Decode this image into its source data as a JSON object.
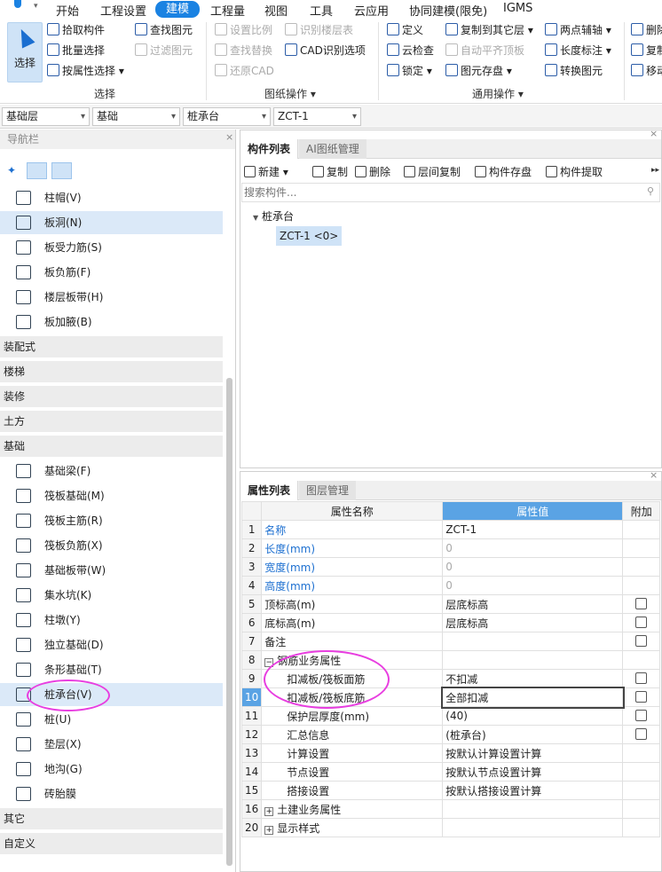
{
  "menu": {
    "items": [
      "开始",
      "工程设置",
      "建模",
      "工程量",
      "视图",
      "工具",
      "云应用",
      "协同建模(限免)",
      "IGMS"
    ],
    "active": "建模"
  },
  "ribbon": {
    "select_label": "选择",
    "select_group": {
      "buttons": [
        "拾取构件",
        "批量选择",
        "按属性选择",
        "查找图元",
        "过滤图元"
      ],
      "group_label": "选择"
    },
    "drawing_group": {
      "buttons": [
        "设置比例",
        "识别楼层表",
        "查找替换",
        "CAD识别选项",
        "还原CAD"
      ],
      "group_label": "图纸操作"
    },
    "common_group": {
      "buttons": [
        "定义",
        "复制到其它层",
        "两点辅轴",
        "云检查",
        "自动平齐顶板",
        "长度标注",
        "锁定",
        "图元存盘",
        "转换图元"
      ],
      "group_label": "通用操作"
    },
    "more_group": {
      "buttons": [
        "删除",
        "复制",
        "移动"
      ]
    }
  },
  "selectors": {
    "floor": "基础层",
    "category": "基础",
    "type": "桩承台",
    "item": "ZCT-1"
  },
  "nav": {
    "title": "导航栏",
    "top_items": [
      "柱帽(V)",
      "板洞(N)",
      "板受力筋(S)",
      "板负筋(F)",
      "楼层板带(H)",
      "板加腋(B)"
    ],
    "selected_top": "板洞(N)",
    "categories": [
      "装配式",
      "楼梯",
      "装修",
      "土方",
      "基础"
    ],
    "foundation_items": [
      "基础梁(F)",
      "筏板基础(M)",
      "筏板主筋(R)",
      "筏板负筋(X)",
      "基础板带(W)",
      "集水坑(K)",
      "柱墩(Y)",
      "独立基础(D)",
      "条形基础(T)",
      "桩承台(V)",
      "桩(U)",
      "垫层(X)",
      "地沟(G)",
      "砖胎膜"
    ],
    "selected_foundation": "桩承台(V)",
    "bottom_categories": [
      "其它",
      "自定义"
    ]
  },
  "component_list": {
    "tabs": [
      "构件列表",
      "AI图纸管理"
    ],
    "tools": [
      "新建",
      "复制",
      "删除",
      "层间复制",
      "构件存盘",
      "构件提取"
    ],
    "search_placeholder": "搜索构件...",
    "tree_root": "桩承台",
    "tree_child": "ZCT-1 <0>"
  },
  "properties": {
    "tabs": [
      "属性列表",
      "图层管理"
    ],
    "headers": {
      "name": "属性名称",
      "value": "属性值",
      "extra": "附加"
    },
    "rows": [
      {
        "n": "1",
        "name": "名称",
        "value": "ZCT-1",
        "checkbox": false
      },
      {
        "n": "2",
        "name": "长度(mm)",
        "value": "0",
        "checkbox": false
      },
      {
        "n": "3",
        "name": "宽度(mm)",
        "value": "0",
        "checkbox": false
      },
      {
        "n": "4",
        "name": "高度(mm)",
        "value": "0",
        "checkbox": false
      },
      {
        "n": "5",
        "name": "顶标高(m)",
        "value": "层底标高",
        "checkbox": true
      },
      {
        "n": "6",
        "name": "底标高(m)",
        "value": "层底标高",
        "checkbox": true
      },
      {
        "n": "7",
        "name": "备注",
        "value": "",
        "checkbox": true
      },
      {
        "n": "8",
        "name": "钢筋业务属性",
        "value": "",
        "checkbox": false
      },
      {
        "n": "9",
        "name": "扣减板/筏板面筋",
        "value": "不扣减",
        "checkbox": true
      },
      {
        "n": "10",
        "name": "扣减板/筏板底筋",
        "value": "全部扣减",
        "checkbox": true
      },
      {
        "n": "11",
        "name": "保护层厚度(mm)",
        "value": "(40)",
        "checkbox": true
      },
      {
        "n": "12",
        "name": "汇总信息",
        "value": "(桩承台)",
        "checkbox": true
      },
      {
        "n": "13",
        "name": "计算设置",
        "value": "按默认计算设置计算",
        "checkbox": false
      },
      {
        "n": "14",
        "name": "节点设置",
        "value": "按默认节点设置计算",
        "checkbox": false
      },
      {
        "n": "15",
        "name": "搭接设置",
        "value": "按默认搭接设置计算",
        "checkbox": false
      },
      {
        "n": "16",
        "name": "土建业务属性",
        "value": "",
        "checkbox": false
      },
      {
        "n": "20",
        "name": "显示样式",
        "value": "",
        "checkbox": false
      }
    ]
  },
  "colors": {
    "accent": "#1a82e2",
    "annotation": "#e83ee0",
    "selected_row": "#dbe9f8"
  }
}
